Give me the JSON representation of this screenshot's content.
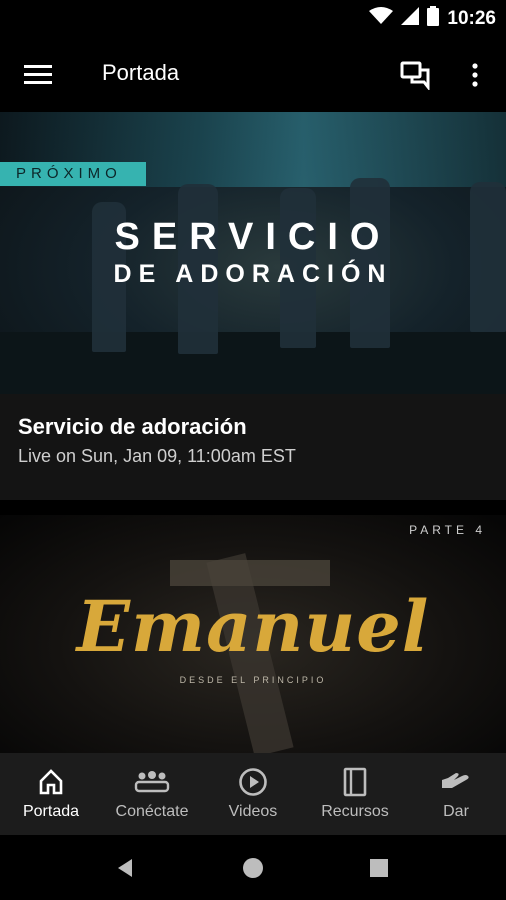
{
  "status": {
    "time": "10:26"
  },
  "appbar": {
    "title": "Portada",
    "menu_icon": "hamburger-icon",
    "chat_icon": "chat-icon",
    "more_icon": "more-vert-icon"
  },
  "feed": [
    {
      "badge": "PRÓXIMO",
      "hero_line1": "SERVICIO",
      "hero_line2": "DE ADORACIÓN",
      "title": "Servicio de adoración",
      "subtitle": "Live on Sun, Jan 09, 11:00am EST"
    },
    {
      "part_label": "PARTE 4",
      "hero_title": "Emanuel",
      "hero_subtitle": "DESDE EL PRINCIPIO"
    }
  ],
  "bottom_nav": [
    {
      "label": "Portada",
      "icon": "home-icon",
      "active": true
    },
    {
      "label": "Conéctate",
      "icon": "group-icon",
      "active": false
    },
    {
      "label": "Videos",
      "icon": "play-circle-icon",
      "active": false
    },
    {
      "label": "Recursos",
      "icon": "book-icon",
      "active": false
    },
    {
      "label": "Dar",
      "icon": "give-hand-icon",
      "active": false
    }
  ],
  "colors": {
    "accent_teal": "#36b3b0",
    "gold": "#d8a83a",
    "nav_bg": "#1c1c1c"
  }
}
